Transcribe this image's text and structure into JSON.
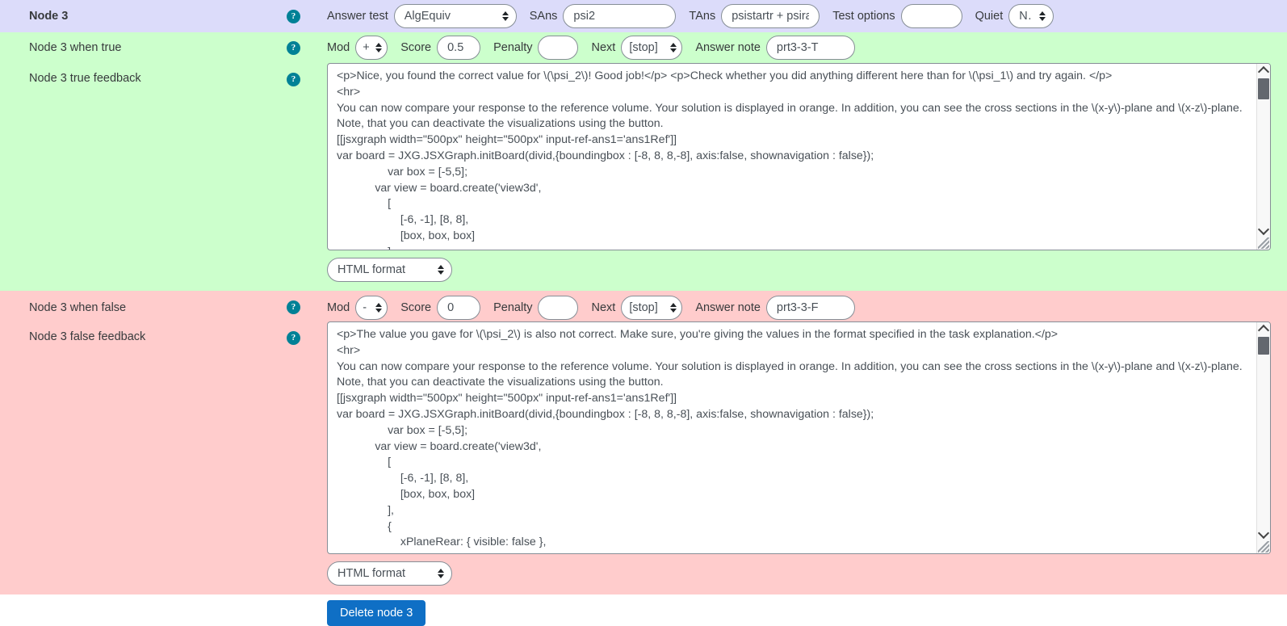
{
  "node": {
    "title": "Node 3",
    "help_icon": "question-mark-circle-icon"
  },
  "header": {
    "answer_test_label": "Answer test",
    "answer_test_value": "AlgEquiv",
    "sans_label": "SAns",
    "sans_value": "psi2",
    "tans_label": "TAns",
    "tans_value": "psistartr + psirange",
    "test_options_label": "Test options",
    "test_options_value": "",
    "quiet_label": "Quiet",
    "quiet_value": "No"
  },
  "true_branch": {
    "row_label": "Node 3 when true",
    "mod_label": "Mod",
    "mod_value": "+",
    "score_label": "Score",
    "score_value": "0.5",
    "penalty_label": "Penalty",
    "penalty_value": "",
    "next_label": "Next",
    "next_value": "[stop]",
    "answer_note_label": "Answer note",
    "answer_note_value": "prt3-3-T",
    "feedback_label": "Node 3 true feedback",
    "feedback_text": "<p>Nice, you found the correct value for \\(\\psi_2\\)! Good job!</p> <p>Check whether you did anything different here than for \\(\\psi_1\\) and try again. </p>\n<hr>\nYou can now compare your response to the reference volume. Your solution is displayed in orange. In addition, you can see the cross sections in the \\(x-y\\)-plane and \\(x-z\\)-plane. Note, that you can deactivate the visualizations using the button.\n[[jsxgraph width=\"500px\" height=\"500px\" input-ref-ans1='ans1Ref']]\nvar board = JXG.JSXGraph.initBoard(divid,{boundingbox : [-8, 8, 8,-8], axis:false, shownavigation : false});\n                var box = [-5,5];\n            var view = board.create('view3d',\n                [\n                    [-6, -1], [8, 8],\n                    [box, box, box]\n                ]",
    "format_value": "HTML format"
  },
  "false_branch": {
    "row_label": "Node 3 when false",
    "mod_label": "Mod",
    "mod_value": "-",
    "score_label": "Score",
    "score_value": "0",
    "penalty_label": "Penalty",
    "penalty_value": "",
    "next_label": "Next",
    "next_value": "[stop]",
    "answer_note_label": "Answer note",
    "answer_note_value": "prt3-3-F",
    "feedback_label": "Node 3 false feedback",
    "feedback_text": "<p>The value you gave for \\(\\psi_2\\) is also not correct. Make sure, you're giving the values in the format specified in the task explanation.</p>\n<hr>\nYou can now compare your response to the reference volume. Your solution is displayed in orange. In addition, you can see the cross sections in the \\(x-y\\)-plane and \\(x-z\\)-plane. Note, that you can deactivate the visualizations using the button.\n[[jsxgraph width=\"500px\" height=\"500px\" input-ref-ans1='ans1Ref']]\nvar board = JXG.JSXGraph.initBoard(divid,{boundingbox : [-8, 8, 8,-8], axis:false, shownavigation : false});\n                var box = [-5,5];\n            var view = board.create('view3d',\n                [\n                    [-6, -1], [8, 8],\n                    [box, box, box]\n                ],\n                {\n                    xPlaneRear: { visible: false },\n                    yPlaneRear: { visible: false },",
    "format_value": "HTML format"
  },
  "footer": {
    "delete_button": "Delete node 3"
  },
  "colors": {
    "header_bg": "#dcdcfa",
    "true_bg": "#ccffcc",
    "false_bg": "#ffcccc",
    "help_icon": "#008196",
    "primary_button": "#0f6fc5"
  }
}
